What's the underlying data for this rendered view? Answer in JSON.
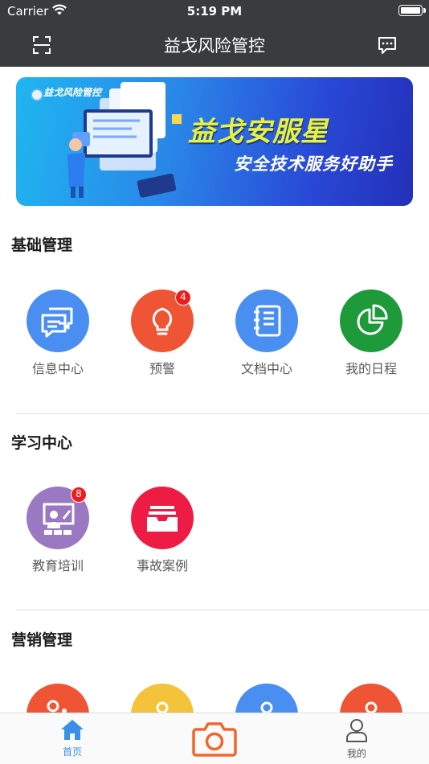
{
  "status_bar": {
    "carrier": "Carrier",
    "time": "5:19 PM"
  },
  "nav": {
    "title": "益戈风险管控",
    "left_icon": "scan-icon",
    "right_icon": "message-icon"
  },
  "banner": {
    "brand": "益戈风险管控",
    "title": "益戈安服星",
    "subtitle": "安全技术服务好助手"
  },
  "sections": [
    {
      "title": "基础管理",
      "items": [
        {
          "label": "信息中心",
          "icon": "chat-icon",
          "color": "#4a8ef2"
        },
        {
          "label": "预警",
          "icon": "bulb-icon",
          "color": "#ef5435",
          "badge": "4"
        },
        {
          "label": "文档中心",
          "icon": "notebook-icon",
          "color": "#4a8ef2"
        },
        {
          "label": "我的日程",
          "icon": "pie-chart-icon",
          "color": "#1e9a3a"
        }
      ]
    },
    {
      "title": "学习中心",
      "items": [
        {
          "label": "教育培训",
          "icon": "classroom-icon",
          "color": "#9a79c2",
          "badge": "8"
        },
        {
          "label": "事故案例",
          "icon": "inbox-icon",
          "color": "#ee1b45"
        }
      ]
    },
    {
      "title": "营销管理",
      "items": [
        {
          "label": "",
          "icon": "marketing-icon-1",
          "color": "#ef5435"
        },
        {
          "label": "",
          "icon": "marketing-icon-2",
          "color": "#f5c33b"
        },
        {
          "label": "",
          "icon": "marketing-icon-3",
          "color": "#4a8ef2"
        },
        {
          "label": "",
          "icon": "marketing-icon-4",
          "color": "#ef5435"
        }
      ]
    }
  ],
  "tab_bar": {
    "home_label": "首页",
    "mine_label": "我的",
    "accent": "#3b8fe8",
    "camera_color": "#f0662c"
  }
}
